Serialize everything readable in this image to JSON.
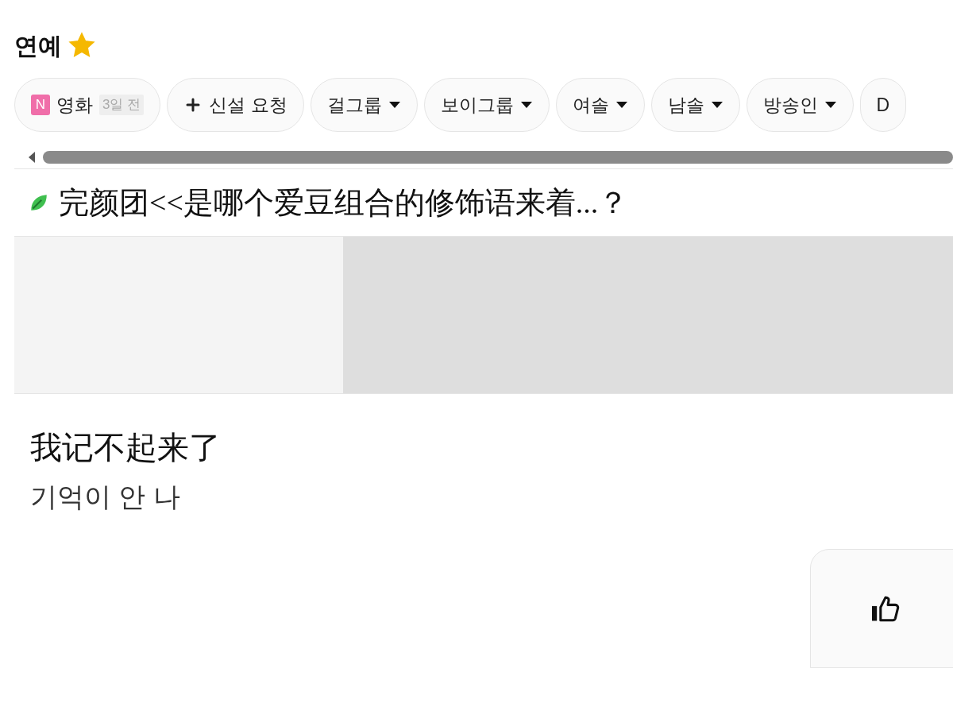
{
  "board": {
    "title": "연예",
    "favorite": true
  },
  "chips": [
    {
      "kind": "new",
      "badge": "N",
      "label": "영화",
      "time": "3일 전"
    },
    {
      "kind": "request",
      "label": "신설 요청"
    },
    {
      "kind": "dropdown",
      "label": "걸그룹"
    },
    {
      "kind": "dropdown",
      "label": "보이그룹"
    },
    {
      "kind": "dropdown",
      "label": "여솔"
    },
    {
      "kind": "dropdown",
      "label": "남솔"
    },
    {
      "kind": "dropdown",
      "label": "방송인"
    },
    {
      "kind": "plain",
      "label": "D"
    }
  ],
  "post": {
    "title": "完颜团<<是哪个爱豆组合的修饰语来着...？",
    "body": [
      "我记不起来了",
      "기억이 안 나"
    ]
  }
}
